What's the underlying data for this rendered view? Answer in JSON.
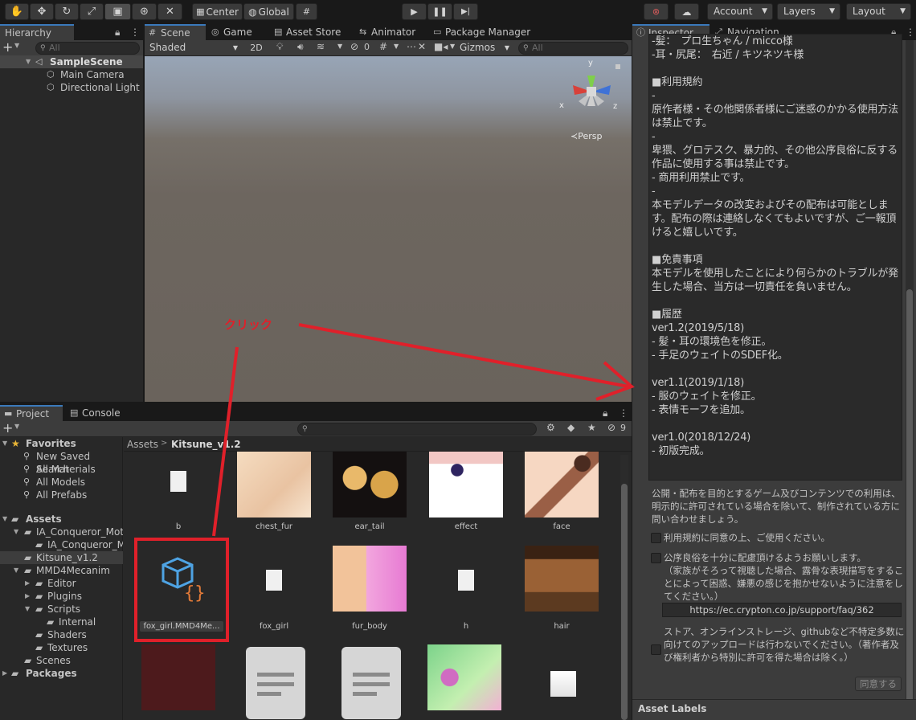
{
  "toolbar": {
    "center_label": "Center",
    "global_label": "Global",
    "account_label": "Account",
    "layers_label": "Layers",
    "layout_label": "Layout"
  },
  "hierarchy": {
    "tab": "Hierarchy",
    "search_placeholder": "All",
    "scene": "SampleScene",
    "items": [
      "Main Camera",
      "Directional Light"
    ]
  },
  "scene_tabs": {
    "scene": "Scene",
    "game": "Game",
    "asset_store": "Asset Store",
    "animator": "Animator",
    "package_manager": "Package Manager"
  },
  "scene_toolbar": {
    "shaded": "Shaded",
    "mode_2d": "2D",
    "hidden_count": "0",
    "gizmos": "Gizmos",
    "search_placeholder": "All",
    "persp": "Persp",
    "axis_x": "x",
    "axis_y": "y",
    "axis_z": "z"
  },
  "annotation": {
    "click_label": "クリック",
    "accent": "#e0202a"
  },
  "project": {
    "tab_project": "Project",
    "tab_console": "Console",
    "hidden_count": "9",
    "breadcrumb_root": "Assets",
    "breadcrumb_current": "Kitsune_v1.2",
    "favorites_label": "Favorites",
    "favorites": [
      "New Saved Search",
      "All Materials",
      "All Models",
      "All Prefabs"
    ],
    "assets_label": "Assets",
    "folders": [
      "IA_Conqueror_Motio",
      "IA_Conqueror_Mo",
      "Kitsune_v1.2",
      "MMD4Mecanim",
      "Editor",
      "Plugins",
      "Scripts",
      "Internal",
      "Shaders",
      "Textures",
      "Scenes"
    ],
    "packages_label": "Packages",
    "grid_row1": [
      "b",
      "chest_fur",
      "ear_tail",
      "effect",
      "face"
    ],
    "grid_row2": [
      "fox_girl.MMD4Me...",
      "fox_girl",
      "fur_body",
      "h",
      "hair"
    ]
  },
  "inspector": {
    "tab_inspector": "Inspector",
    "tab_navigation": "Navigation",
    "text": "-髪：　プロ生ちゃん / micco様\n-耳・尻尾：　右近 / キツネツキ様\n\n■利用規約\n-\n原作者様・その他関係者様にご迷惑のかかる使用方法は禁止です。\n-\n卑猥、グロテスク、暴力的、その他公序良俗に反する作品に使用する事は禁止です。\n- 商用利用禁止です。\n-\n本モデルデータの改変およびその配布は可能とします。配布の際は連絡しなくてもよいですが、ご一報頂けると嬉しいです。\n\n■免責事項\n本モデルを使用したことにより何らかのトラブルが発生した場合、当方は一切責任を負いません。\n\n■履歴\nver1.2(2019/5/18)\n- 髪・耳の環境色を修正。\n- 手足のウェイトのSDEF化。\n\nver1.1(2019/1/18)\n- 服のウェイトを修正。\n- 表情モーフを追加。\n\nver1.0(2018/12/24)\n- 初版完成。",
    "notice": "公開・配布を目的とするゲーム及びコンテンツでの利用は、明示的に許可されている場合を除いて、制作されている方に問い合わせましょう。",
    "check1": "利用規約に同意の上、ご使用ください。",
    "check2": "公序良俗を十分に配慮頂けるようお願いします。\n（家族がそろって視聴した場合、露骨な表現描写をすることによって困惑、嫌悪の感じを抱かせないように注意をしてください。）",
    "url": "https://ec.crypton.co.jp/support/faq/362",
    "check3": "ストア、オンラインストレージ、githubなど不特定多数に向けてのアップロードは行わないでください。（著作者及び権利者から特別に許可を得た場合は除く。）",
    "agree_button": "同意する",
    "asset_labels": "Asset Labels"
  }
}
